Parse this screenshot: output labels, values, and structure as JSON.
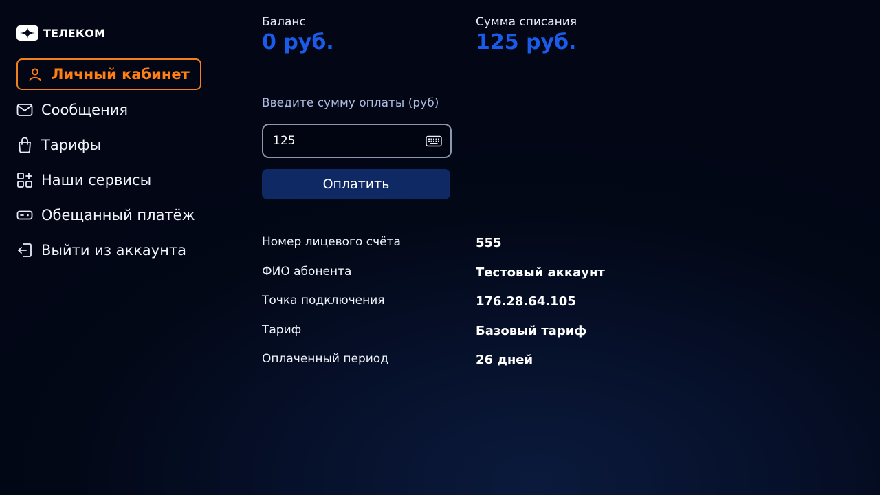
{
  "brand": {
    "logo_icon": "telecom-logo-icon",
    "name": "ТЕЛЕКОМ"
  },
  "nav": {
    "items": [
      {
        "label": "Личный кабинет",
        "icon": "user-icon",
        "active": true
      },
      {
        "label": "Сообщения",
        "icon": "envelope-icon"
      },
      {
        "label": "Тарифы",
        "icon": "shopping-bag-icon"
      },
      {
        "label": "Наши сервисы",
        "icon": "grid-plus-icon"
      },
      {
        "label": "Обещанный платёж",
        "icon": "ticket-icon"
      },
      {
        "label": "Выйти из аккаунта",
        "icon": "logout-icon"
      }
    ]
  },
  "balance": {
    "caption": "Баланс",
    "value": "0 руб."
  },
  "charge": {
    "caption": "Сумма списания",
    "value": "125 руб."
  },
  "payment": {
    "label": "Введите сумму оплаты (руб)",
    "amount": "125",
    "keyboard_icon": "keyboard-icon",
    "button_label": "Оплатить"
  },
  "account_info": [
    {
      "key": "Номер лицевого счёта",
      "value": "555"
    },
    {
      "key": "ФИО абонента",
      "value": "Тестовый аккаунт"
    },
    {
      "key": "Точка подключения",
      "value": "176.28.64.105"
    },
    {
      "key": "Тариф",
      "value": "Базовый тариф"
    },
    {
      "key": "Оплаченный период",
      "value": "26 дней"
    }
  ],
  "colors": {
    "accent_active": "#ff7f14",
    "accent_value": "#1a5be9",
    "button_bg": "#0e2964",
    "background": "#030817"
  }
}
